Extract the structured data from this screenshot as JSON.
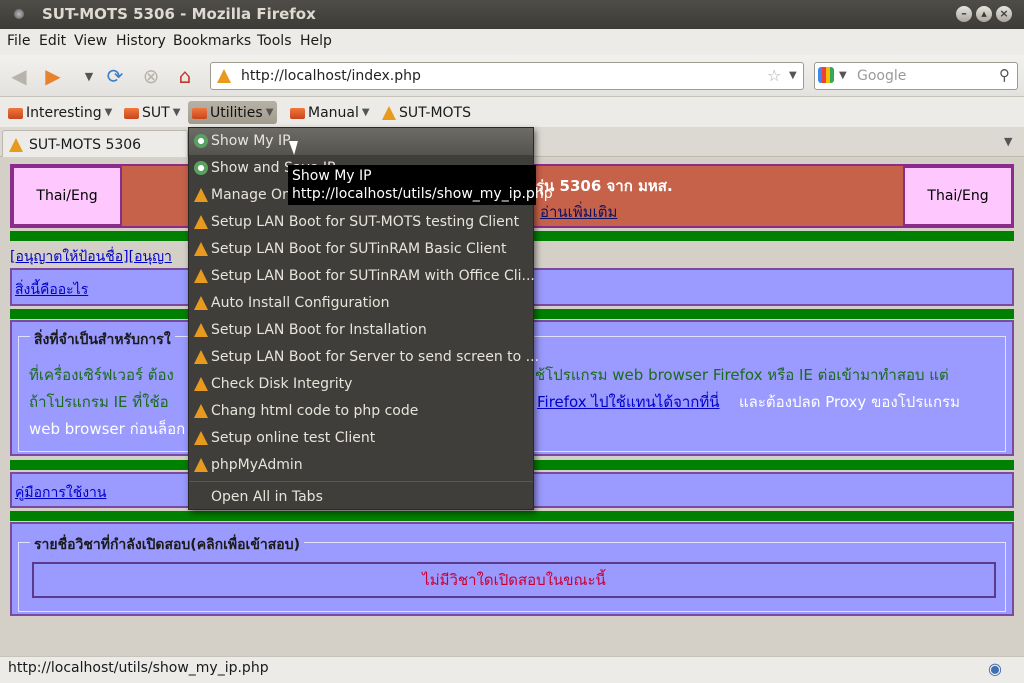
{
  "window": {
    "title": "SUT-MOTS 5306 - Mozilla Firefox"
  },
  "menubar": [
    "File",
    "Edit",
    "View",
    "History",
    "Bookmarks",
    "Tools",
    "Help"
  ],
  "nav": {
    "url": "http://localhost/index.php",
    "search_placeholder": "Google"
  },
  "bookmarks": [
    {
      "label": "Interesting",
      "type": "folder"
    },
    {
      "label": "SUT",
      "type": "folder"
    },
    {
      "label": "Utilities",
      "type": "folder",
      "selected": true
    },
    {
      "label": "Manual",
      "type": "folder"
    },
    {
      "label": "SUT-MOTS",
      "type": "link"
    }
  ],
  "tab": {
    "title": "SUT-MOTS 5306"
  },
  "page": {
    "lang_left": "Thai/Eng",
    "lang_right": "Thai/Eng",
    "header_line1": "รุ่น 5306 จาก มหส.",
    "header_more": "อ่านเพิ่มเติม",
    "permission_links": "[อนุญาตให้ป้อนชื่อ][อนุญา",
    "what_is_link": "สิ่งนี้คืออะไร",
    "requirements_title": "สิ่งที่จำเป็นสำหรับการใ",
    "req_line1_a": "ที่เครื่องเซิร์ฟเวอร์ ต้อง",
    "req_line1_b": "ช้โปรแกรม web browser Firefox หรือ IE ต่อเข้ามาทำสอบ แต่",
    "req_line2_a": "ถ้าโปรแกรม IE ที่ใช้อ",
    "req_line2_link": "Firefox ไปใช้แทนได้จากที่นี่",
    "req_line2_b": "และต้องปลด Proxy ของโปรแกรม",
    "req_line3": "web browser ก่อนล็อก",
    "manual_link": "คู่มือการใช้งาน",
    "courses_title": "รายชื่อวิชาที่กำลังเปิดสอบ(คลิกเพื่อเข้าสอบ)",
    "no_courses": "ไม่มีวิชาใดเปิดสอบในขณะนี้"
  },
  "dropdown": {
    "items": [
      {
        "label": "Show My IP",
        "icon": "globe-icon"
      },
      {
        "label": "Show and Save IP",
        "icon": "globe-icon"
      },
      {
        "label": "Manage Onl",
        "icon": "cone-icon"
      },
      {
        "label": "Setup LAN Boot for SUT-MOTS testing Client",
        "icon": "cone-icon"
      },
      {
        "label": "Setup LAN Boot for SUTinRAM Basic Client",
        "icon": "cone-icon"
      },
      {
        "label": "Setup LAN Boot for SUTinRAM with Office Cli...",
        "icon": "cone-icon"
      },
      {
        "label": "Auto Install Configuration",
        "icon": "cone-icon"
      },
      {
        "label": "Setup LAN Boot for Installation",
        "icon": "cone-icon"
      },
      {
        "label": "Setup LAN Boot for Server to send screen to ...",
        "icon": "cone-icon"
      },
      {
        "label": "Check Disk Integrity",
        "icon": "cone-icon"
      },
      {
        "label": "Chang html code to php code",
        "icon": "cone-icon"
      },
      {
        "label": "Setup online test Client",
        "icon": "cone-icon"
      },
      {
        "label": "phpMyAdmin",
        "icon": "cone-icon"
      }
    ],
    "open_all": "Open All in Tabs"
  },
  "tooltip": {
    "title": "Show My IP",
    "url": "http://localhost/utils/show_my_ip.php"
  },
  "status": {
    "text": "http://localhost/utils/show_my_ip.php"
  }
}
